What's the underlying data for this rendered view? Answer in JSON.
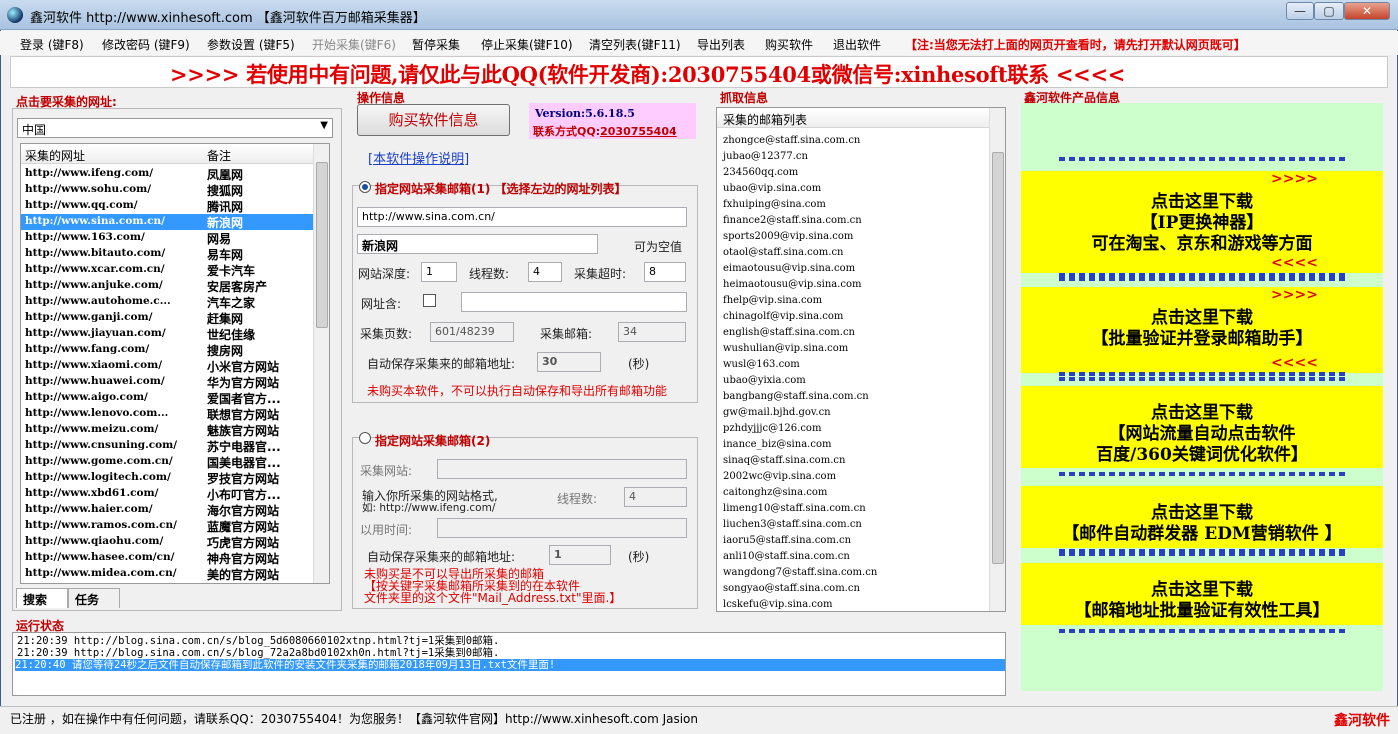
{
  "window": {
    "title": "鑫河软件 http://www.xinhesoft.com 【鑫河软件百万邮箱采集器】",
    "min_label": "—",
    "max_label": "▢",
    "close_label": "✕"
  },
  "menu": [
    {
      "label": "登录 (键F8)",
      "enabled": true
    },
    {
      "label": "修改密码 (键F9)",
      "enabled": true
    },
    {
      "label": "参数设置 (键F5)",
      "enabled": true
    },
    {
      "label": "开始采集(键F6)",
      "enabled": false
    },
    {
      "label": "暂停采集",
      "enabled": true
    },
    {
      "label": "停止采集(键F10)",
      "enabled": true
    },
    {
      "label": "清空列表(键F11)",
      "enabled": true
    },
    {
      "label": "导出列表",
      "enabled": true
    },
    {
      "label": "购买软件",
      "enabled": true
    },
    {
      "label": "退出软件",
      "enabled": true
    },
    {
      "label": "【注:当您无法打上面的网页开查看时，请先打开默认网页既可】",
      "enabled": true,
      "warning": true
    }
  ],
  "banner": ">>>> 若使用中有问题,请仅此与此QQ(软件开发商):2030755404或微信号:xinhesoft联系  <<<<",
  "left": {
    "group_title": "点击要采集的网址:",
    "region_value": "中国",
    "columns": [
      "采集的网址",
      "备注"
    ],
    "rows": [
      {
        "url": "http://www.ifeng.com/",
        "note": "凤凰网"
      },
      {
        "url": "http://www.sohu.com/",
        "note": "搜狐网"
      },
      {
        "url": "http://www.qq.com/",
        "note": "腾讯网"
      },
      {
        "url": "http://www.sina.com.cn/",
        "note": "新浪网",
        "selected": true
      },
      {
        "url": "http://www.163.com/",
        "note": "网易"
      },
      {
        "url": "http://www.bitauto.com/",
        "note": "易车网"
      },
      {
        "url": "http://www.xcar.com.cn/",
        "note": "爱卡汽车"
      },
      {
        "url": "http://www.anjuke.com/",
        "note": "安居客房产"
      },
      {
        "url": "http://www.autohome.c...",
        "note": "汽车之家"
      },
      {
        "url": "http://www.ganji.com/",
        "note": "赶集网"
      },
      {
        "url": "http://www.jiayuan.com/",
        "note": "世纪佳缘"
      },
      {
        "url": "http://www.fang.com/",
        "note": "搜房网"
      },
      {
        "url": "http://www.xiaomi.com/",
        "note": "小米官方网站"
      },
      {
        "url": "http://www.huawei.com/",
        "note": "华为官方网站"
      },
      {
        "url": "http://www.aigo.com/",
        "note": "爱国者官方..."
      },
      {
        "url": "http://www.lenovo.com...",
        "note": "联想官方网站"
      },
      {
        "url": "http://www.meizu.com/",
        "note": "魅族官方网站"
      },
      {
        "url": "http://www.cnsuning.com/",
        "note": "苏宁电器官..."
      },
      {
        "url": "http://www.gome.com.cn/",
        "note": "国美电器官..."
      },
      {
        "url": "http://www.logitech.com/",
        "note": "罗技官方网站"
      },
      {
        "url": "http://www.xbd61.com/",
        "note": "小布叮官方..."
      },
      {
        "url": "http://www.haier.com/",
        "note": "海尔官方网站"
      },
      {
        "url": "http://www.ramos.com.cn/",
        "note": "蓝魔官方网站"
      },
      {
        "url": "http://www.qiaohu.com/",
        "note": "巧虎官方网站"
      },
      {
        "url": "http://www.hasee.com/cn/",
        "note": "神舟官方网站"
      },
      {
        "url": "http://www.midea.com.cn/",
        "note": "美的官方网站"
      }
    ],
    "tabs": [
      "搜索",
      "任务"
    ]
  },
  "ops": {
    "group_title": "操作信息",
    "buy_button": "购买软件信息",
    "version": "Version:5.6.18.5",
    "contact_label": "联系方式QQ:",
    "contact_qq": "2030755404",
    "manual_link": "[本软件操作说明]",
    "mode1_label": "指定网站采集邮箱(1) 【选择左边的网址列表】",
    "mode1_url": "http://www.sina.com.cn/",
    "mode1_name": "新浪网",
    "optional_hint": "可为空值",
    "depth_label": "网站深度:",
    "depth_value": "1",
    "threads_label": "线程数:",
    "threads_value": "4",
    "timeout_label": "采集超时:",
    "timeout_value": "8",
    "urlmatch_label": "网址含:",
    "urlmatch_value": "",
    "pages_label": "采集页数:",
    "pages_value": "601/48239",
    "emails_label": "采集邮箱:",
    "emails_value": "34",
    "autosave_label": "自动保存采集来的邮箱地址:",
    "autosave_value": "30",
    "seconds_label": "(秒)",
    "mode1_warning": "未购买本软件，不可以执行自动保存和导出所有邮箱功能",
    "mode2_label": "指定网站采集邮箱(2)",
    "site_label": "采集网站:",
    "site_value": "",
    "format_line1": "输入你所采集的网站格式,",
    "format_line2": "如: http://www.ifeng.com/",
    "threads2_label": "线程数:",
    "threads2_value": "4",
    "elapsed_label": "以用时间:",
    "elapsed_value": "",
    "autosave2_label": "自动保存采集来的邮箱地址:",
    "autosave2_value": "1",
    "seconds2_label": "(秒)",
    "mode2_warning1": "未购买是不可以导出所采集的邮箱",
    "mode2_warning2": "【按关键字采集邮箱所采集到的在本软件",
    "mode2_warning3": "文件夹里的这个文件\"Mail_Address.txt\"里面.】"
  },
  "capture": {
    "group_title": "抓取信息",
    "column": "采集的邮箱列表",
    "emails": [
      "zhongce@staff.sina.com.cn",
      "jubao@12377.cn",
      "234560qq.com",
      "ubao@vip.sina.com",
      "fxhuiping@sina.com",
      "finance2@staff.sina.com.cn",
      "sports2009@vip.sina.com",
      "otaol@staff.sina.com.cn",
      "eimaotousu@vip.sina.com",
      "heimaotousu@vip.sina.com",
      "fhelp@vip.sina.com",
      "chinagolf@vip.sina.com",
      "english@staff.sina.com.cn",
      "wushulian@vip.sina.com",
      "wusl@163.com",
      "ubao@yixia.com",
      "bangbang@staff.sina.com.cn",
      "gw@mail.bjhd.gov.cn",
      "pzhdyjjjc@126.com",
      "inance_biz@sina.com",
      "sinaq@staff.sina.com.cn",
      "2002wc@vip.sina.com",
      "caitonghz@sina.com",
      "limeng10@staff.sina.com.cn",
      "liuchen3@staff.sina.com.cn",
      "iaoru5@staff.sina.com.cn",
      "anli10@staff.sina.com.cn",
      "wangdong7@staff.sina.com.cn",
      "songyao@staff.sina.com.cn",
      "lcskefu@vip.sina.com"
    ]
  },
  "products": {
    "group_title": "鑫河软件产品信息",
    "ads": [
      {
        "arrows_top": ">>>>",
        "line1": "点击这里下载",
        "line2": "【IP更换神器】",
        "line3": "可在淘宝、京东和游戏等方面",
        "arrows_bottom": "<<<<"
      },
      {
        "arrows_top": ">>>>",
        "line1": "点击这里下载",
        "line2": "【批量验证并登录邮箱助手】",
        "line3": "",
        "arrows_bottom": "<<<<"
      },
      {
        "arrows_top": "",
        "line1": "点击这里下载",
        "line2": "【网站流量自动点击软件",
        "line3": "百度/360关键词优化软件】",
        "arrows_bottom": ""
      },
      {
        "arrows_top": "",
        "line1": "点击这里下载",
        "line2": "【邮件自动群发器 EDM营销软件 】",
        "line3": "",
        "arrows_bottom": ""
      },
      {
        "arrows_top": "",
        "line1": "点击这里下载",
        "line2": "【邮箱地址批量验证有效性工具】",
        "line3": "",
        "arrows_bottom": ""
      }
    ]
  },
  "log": {
    "group_title": "运行状态",
    "lines": [
      {
        "text": "21:20:39 http://blog.sina.com.cn/s/blog_5d6080660102xtnp.html?tj=1采集到0邮箱.",
        "selected": false
      },
      {
        "text": "21:20:39 http://blog.sina.com.cn/s/blog_72a2a8bd0102xh0n.html?tj=1采集到0邮箱.",
        "selected": false
      },
      {
        "text": "21:20:40 请您等待24秒之后文件自动保存邮箱到此软件的安装文件夹采集的邮箱2018年09月13日.txt文件里面!",
        "selected": true
      }
    ]
  },
  "statusbar": {
    "text": "已注册 ，如在操作中有任何问题，请联系QQ：2030755404！为您服务！【鑫河软件官网】http://www.xinhesoft.com    Jasion",
    "brand": "鑫河软件"
  },
  "colors": {
    "accent_red": "#e00000",
    "ad_yellow": "#ffff00",
    "ad_bg_green": "#ccffcc",
    "selection_blue": "#3399ff"
  }
}
